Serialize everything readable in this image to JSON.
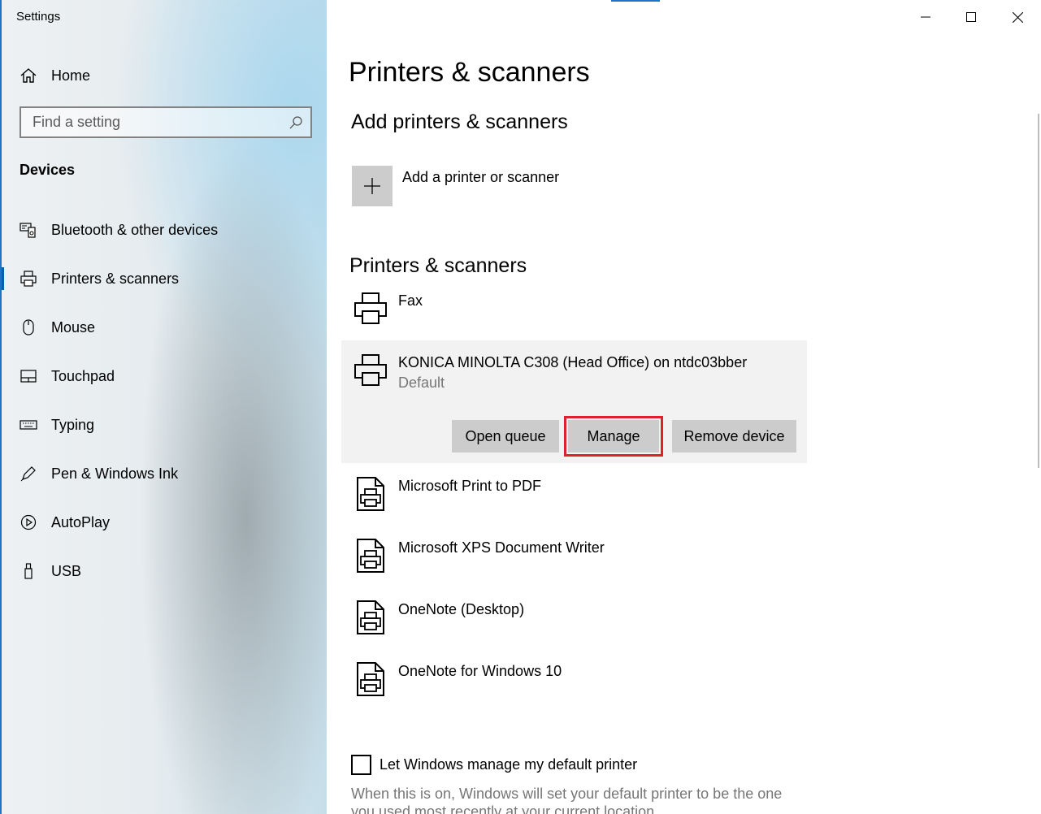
{
  "window": {
    "title": "Settings"
  },
  "sidebar": {
    "home_label": "Home",
    "search_placeholder": "Find a setting",
    "section_title": "Devices",
    "items": [
      {
        "label": "Bluetooth & other devices",
        "icon": "bluetooth-devices-icon"
      },
      {
        "label": "Printers & scanners",
        "icon": "printer-icon",
        "active": true
      },
      {
        "label": "Mouse",
        "icon": "mouse-icon"
      },
      {
        "label": "Touchpad",
        "icon": "touchpad-icon"
      },
      {
        "label": "Typing",
        "icon": "keyboard-icon"
      },
      {
        "label": "Pen & Windows Ink",
        "icon": "pen-icon"
      },
      {
        "label": "AutoPlay",
        "icon": "autoplay-icon"
      },
      {
        "label": "USB",
        "icon": "usb-icon"
      }
    ]
  },
  "main": {
    "page_title": "Printers & scanners",
    "add_section_title": "Add printers & scanners",
    "add_label": "Add a printer or scanner",
    "list_title": "Printers & scanners",
    "printers": [
      {
        "name": "Fax",
        "icon": "printer-icon"
      },
      {
        "name": "KONICA MINOLTA C308 (Head Office) on ntdc03bber",
        "status": "Default",
        "icon": "printer-icon",
        "selected": true
      },
      {
        "name": "Microsoft Print to PDF",
        "icon": "document-printer-icon"
      },
      {
        "name": "Microsoft XPS Document Writer",
        "icon": "document-printer-icon"
      },
      {
        "name": "OneNote (Desktop)",
        "icon": "document-printer-icon"
      },
      {
        "name": "OneNote for Windows 10",
        "icon": "document-printer-icon"
      }
    ],
    "actions": {
      "open_queue": "Open queue",
      "manage": "Manage",
      "remove": "Remove device"
    },
    "default_checkbox": {
      "label": "Let Windows manage my default printer",
      "checked": false
    },
    "description": "When this is on, Windows will set your default printer to be the one you used most recently at your current location."
  },
  "colors": {
    "accent": "#0063b1",
    "highlight": "#e0202a",
    "button_bg": "#cccccc",
    "selected_bg": "#f2f2f2"
  }
}
